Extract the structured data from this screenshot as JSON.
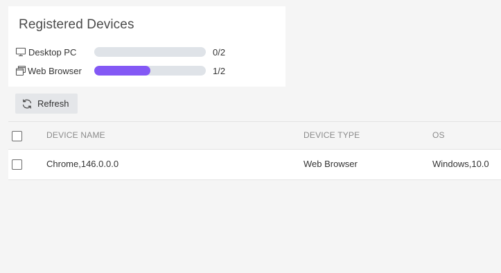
{
  "limits": {
    "title": "Registered Devices",
    "items": [
      {
        "label": "Desktop PC",
        "icon": "monitor-icon",
        "used": 0,
        "max": 2,
        "count_text": "0/2",
        "fill_fraction": 0.0
      },
      {
        "label": "Web Browser",
        "icon": "browser-windows-icon",
        "used": 1,
        "max": 2,
        "count_text": "1/2",
        "fill_fraction": 0.5
      }
    ]
  },
  "toolbar": {
    "refresh_label": "Refresh",
    "refresh_icon": "refresh-icon"
  },
  "table": {
    "columns": [
      "DEVICE NAME",
      "DEVICE TYPE",
      "OS"
    ],
    "rows": [
      {
        "name": "Chrome,146.0.0.0",
        "type": "Web Browser",
        "os": "Windows,10.0",
        "selected": false
      }
    ]
  },
  "colors": {
    "accent": "#8358f5",
    "track": "#dfe3e8",
    "background": "#f5f5f5"
  }
}
